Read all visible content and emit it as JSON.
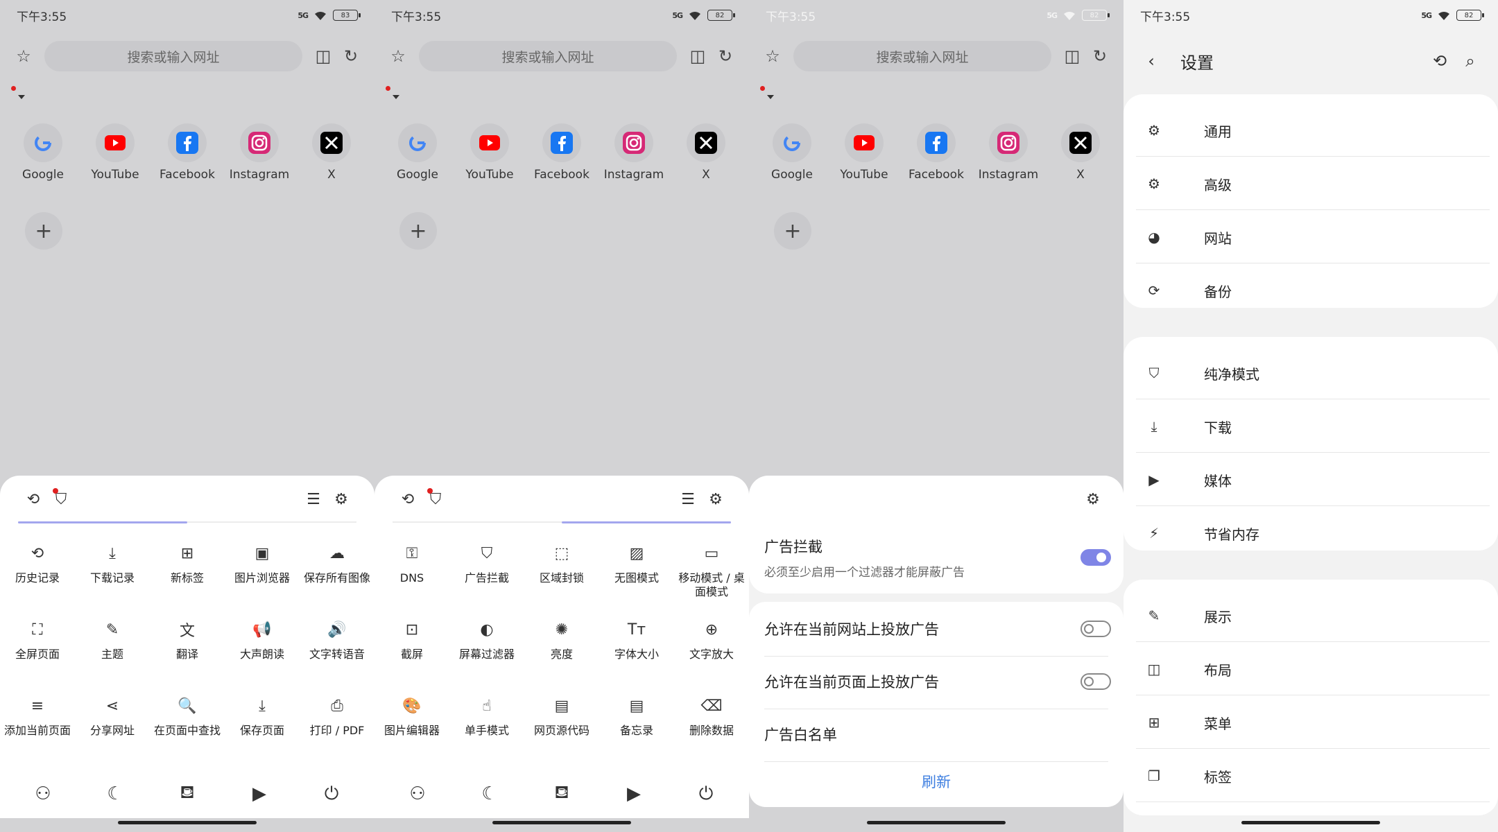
{
  "panels": [
    {
      "battery": "83"
    },
    {
      "battery": "82"
    },
    {
      "battery": "82"
    }
  ],
  "status_time": "下午3:55",
  "signal_text": "5G",
  "search_placeholder": "搜索或输入网址",
  "shortcuts": [
    {
      "label": "Google",
      "icon": "google-icon",
      "color": "#4285f4"
    },
    {
      "label": "YouTube",
      "icon": "youtube-icon",
      "color": "#ff0000"
    },
    {
      "label": "Facebook",
      "icon": "facebook-icon",
      "color": "#1877f2"
    },
    {
      "label": "Instagram",
      "icon": "instagram-icon",
      "color": "#d62976"
    },
    {
      "label": "X",
      "icon": "x-icon",
      "color": "#000000"
    }
  ],
  "menu1": [
    {
      "label": "历史记录",
      "icon": "history-icon",
      "glyph": "⟲"
    },
    {
      "label": "下载记录",
      "icon": "download-icon",
      "glyph": "⤓"
    },
    {
      "label": "新标签",
      "icon": "new-tab-icon",
      "glyph": "⊞"
    },
    {
      "label": "图片浏览器",
      "icon": "image-browser-icon",
      "glyph": "▣"
    },
    {
      "label": "保存所有图像",
      "icon": "save-images-icon",
      "glyph": "☁"
    },
    {
      "label": "全屏页面",
      "icon": "fullscreen-icon",
      "glyph": "⛶"
    },
    {
      "label": "主题",
      "icon": "theme-icon",
      "glyph": "✎"
    },
    {
      "label": "翻译",
      "icon": "translate-icon",
      "glyph": "文"
    },
    {
      "label": "大声朗读",
      "icon": "read-aloud-icon",
      "glyph": "📢"
    },
    {
      "label": "文字转语音",
      "icon": "tts-icon",
      "glyph": "🔊"
    },
    {
      "label": "添加当前页面",
      "icon": "add-page-icon",
      "glyph": "≡"
    },
    {
      "label": "分享网址",
      "icon": "share-icon",
      "glyph": "⋖"
    },
    {
      "label": "在页面中查找",
      "icon": "find-in-page-icon",
      "glyph": "🔍"
    },
    {
      "label": "保存页面",
      "icon": "save-page-icon",
      "glyph": "⤓"
    },
    {
      "label": "打印 / PDF",
      "icon": "print-icon",
      "glyph": "⎙"
    }
  ],
  "menu2": [
    {
      "label": "DNS",
      "icon": "key-icon",
      "glyph": "⚿"
    },
    {
      "label": "广告拦截",
      "icon": "shield-icon",
      "glyph": "⛉"
    },
    {
      "label": "区域封锁",
      "icon": "region-block-icon",
      "glyph": "⬚"
    },
    {
      "label": "无图模式",
      "icon": "no-image-icon",
      "glyph": "▨"
    },
    {
      "label": "移动模式 / 桌面模式",
      "icon": "desktop-icon",
      "glyph": "▭"
    },
    {
      "label": "截屏",
      "icon": "screenshot-icon",
      "glyph": "⊡"
    },
    {
      "label": "屏幕过滤器",
      "icon": "screen-filter-icon",
      "glyph": "◐"
    },
    {
      "label": "亮度",
      "icon": "brightness-icon",
      "glyph": "✺"
    },
    {
      "label": "字体大小",
      "icon": "font-size-icon",
      "glyph": "Tт"
    },
    {
      "label": "文字放大",
      "icon": "zoom-icon",
      "glyph": "⊕"
    },
    {
      "label": "图片编辑器",
      "icon": "palette-icon",
      "glyph": "🎨"
    },
    {
      "label": "单手模式",
      "icon": "one-hand-icon",
      "glyph": "☝"
    },
    {
      "label": "网页源代码",
      "icon": "source-code-icon",
      "glyph": "▤"
    },
    {
      "label": "备忘录",
      "icon": "notes-icon",
      "glyph": "▤"
    },
    {
      "label": "删除数据",
      "icon": "delete-data-icon",
      "glyph": "⌫"
    }
  ],
  "bottom_bar": [
    {
      "icon": "extensions-icon",
      "glyph": "⚇"
    },
    {
      "icon": "night-mode-icon",
      "glyph": "☾"
    },
    {
      "icon": "bookmarks-icon",
      "glyph": "⛾"
    },
    {
      "icon": "video-icon",
      "glyph": "▶"
    },
    {
      "icon": "power-icon",
      "glyph": "⏻"
    }
  ],
  "adblock": {
    "title": "广告拦截",
    "subtitle": "必须至少启用一个过滤器才能屏蔽广告",
    "enabled": true,
    "allow_site": "允许在当前网站上投放广告",
    "allow_site_on": false,
    "allow_page": "允许在当前页面上投放广告",
    "allow_page_on": false,
    "whitelist": "广告白名单",
    "refresh": "刷新"
  },
  "settings": {
    "battery": "82",
    "title": "设置",
    "groups": [
      [
        {
          "label": "通用",
          "icon": "gear-icon",
          "glyph": "⚙"
        },
        {
          "label": "高级",
          "icon": "advanced-gear-icon",
          "glyph": "⚙"
        },
        {
          "label": "网站",
          "icon": "globe-icon",
          "glyph": "◕"
        },
        {
          "label": "备份",
          "icon": "sync-icon",
          "glyph": "⟳"
        }
      ],
      [
        {
          "label": "纯净模式",
          "icon": "shield-icon",
          "glyph": "⛉"
        },
        {
          "label": "下载",
          "icon": "download-icon",
          "glyph": "⤓"
        },
        {
          "label": "媒体",
          "icon": "play-icon",
          "glyph": "▶"
        },
        {
          "label": "节省内存",
          "icon": "memory-icon",
          "glyph": "⚡"
        }
      ],
      [
        {
          "label": "展示",
          "icon": "paint-bucket-icon",
          "glyph": "✎"
        },
        {
          "label": "布局",
          "icon": "layout-icon",
          "glyph": "◫"
        },
        {
          "label": "菜单",
          "icon": "menu-grid-icon",
          "glyph": "⊞"
        },
        {
          "label": "标签",
          "icon": "tabs-icon",
          "glyph": "❐"
        }
      ]
    ]
  },
  "accent_color": "#7f85e6",
  "link_color": "#3f7fe0"
}
